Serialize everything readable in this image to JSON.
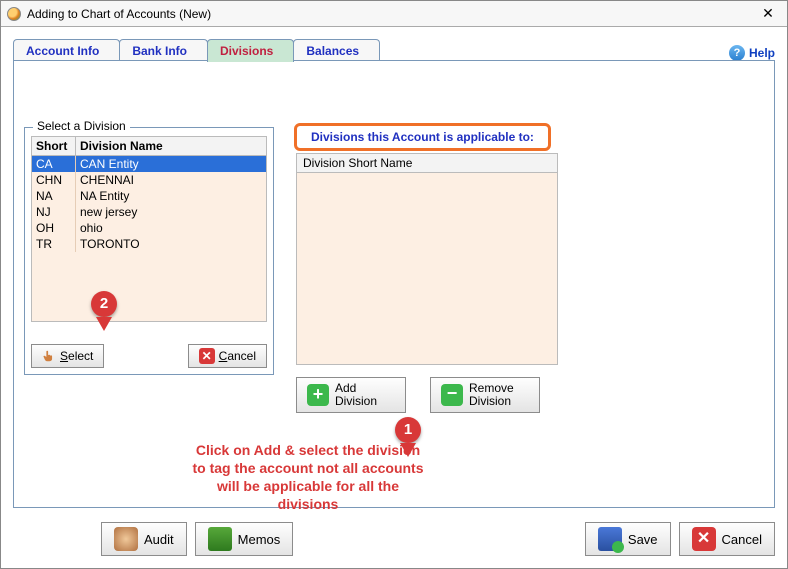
{
  "window": {
    "title": "Adding to Chart of Accounts  (New)"
  },
  "help": {
    "label": "Help"
  },
  "tabs": [
    {
      "label": "Account Info"
    },
    {
      "label": "Bank Info"
    },
    {
      "label": "Divisions"
    },
    {
      "label": "Balances"
    }
  ],
  "select_panel": {
    "legend": "Select a Division",
    "col_short": "Short",
    "col_name": "Division Name",
    "rows": [
      {
        "short": "CA",
        "name": "CAN Entity"
      },
      {
        "short": "CHN",
        "name": "CHENNAI"
      },
      {
        "short": "NA",
        "name": "NA Entity"
      },
      {
        "short": "NJ",
        "name": "new jersey"
      },
      {
        "short": "OH",
        "name": "ohio"
      },
      {
        "short": "TR",
        "name": "TORONTO"
      }
    ],
    "select_btn": "Select",
    "cancel_btn": "Cancel"
  },
  "applicable": {
    "heading": "Divisions this Account is applicable to:",
    "col_header": "Division Short Name",
    "add_btn_l1": "Add",
    "add_btn_l2": "Division",
    "remove_btn_l1": "Remove",
    "remove_btn_l2": "Division"
  },
  "annotation": {
    "text": "Click on Add & select the division to tag the account not all accounts will be applicable for all the divisions",
    "pin1": "1",
    "pin2": "2"
  },
  "bottom": {
    "audit": "Audit",
    "memos": "Memos",
    "save": "Save",
    "cancel": "Cancel"
  }
}
